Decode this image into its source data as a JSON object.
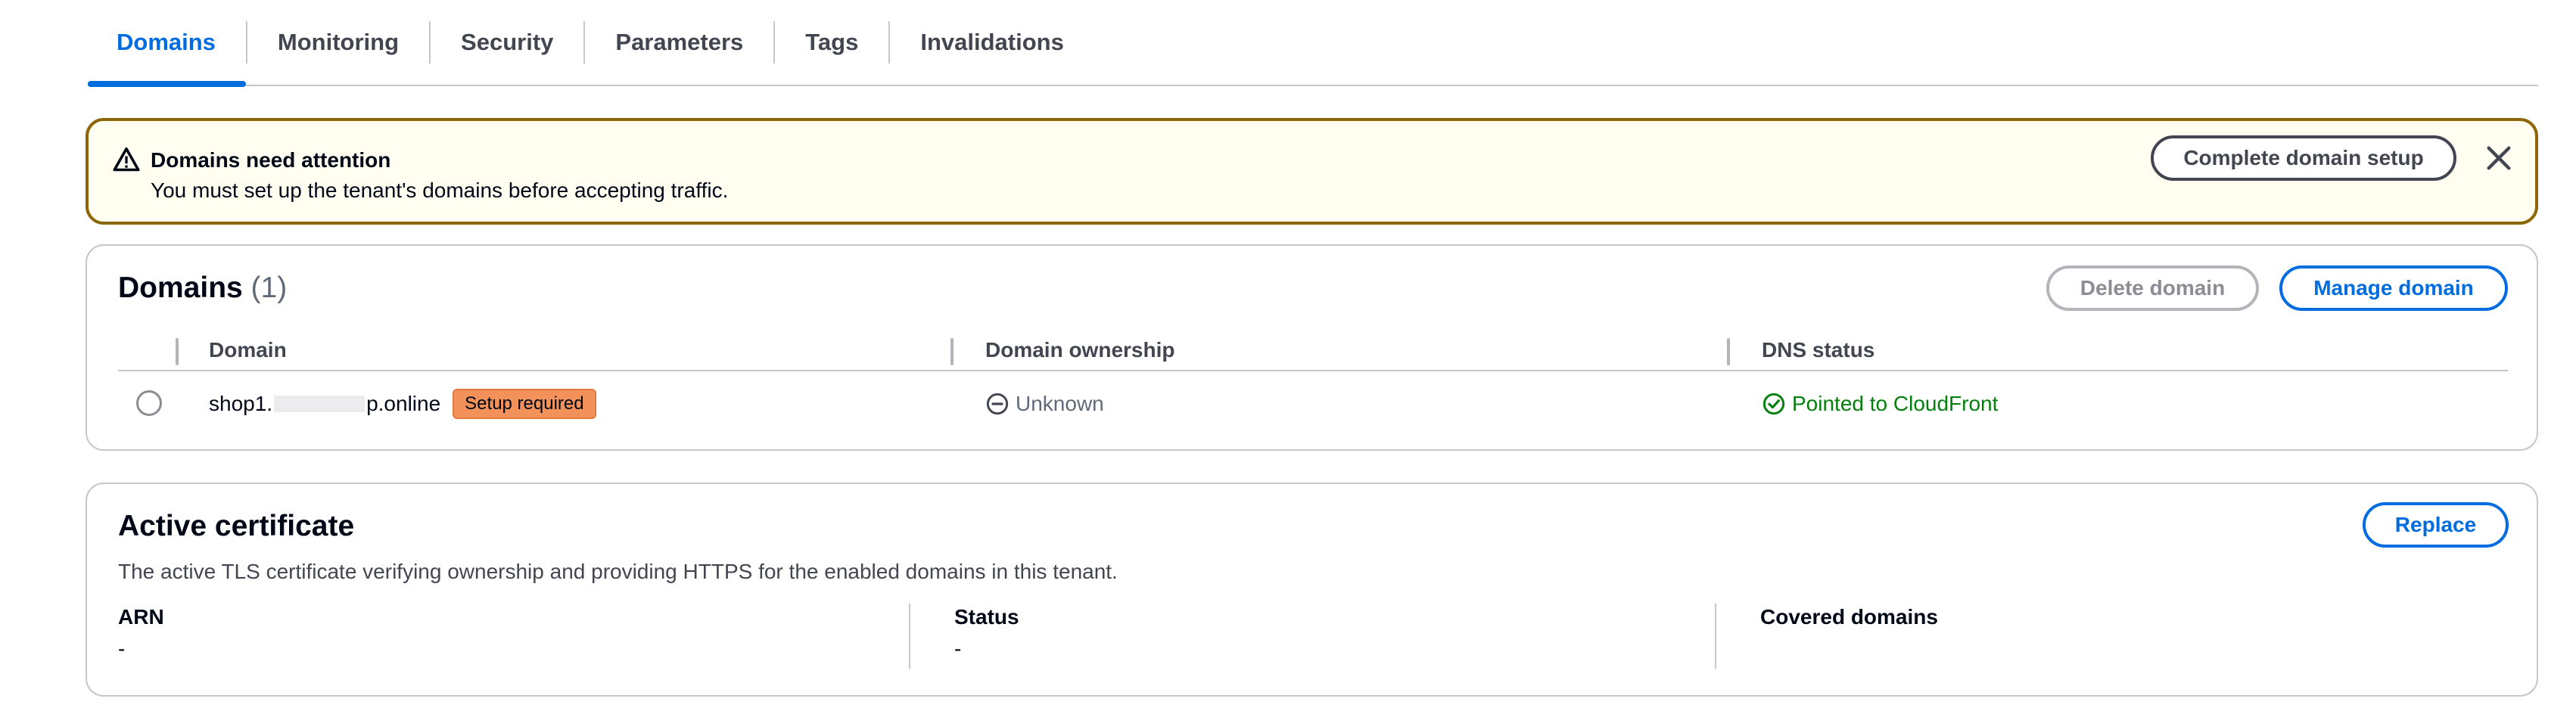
{
  "tabs": [
    {
      "label": "Domains",
      "active": true
    },
    {
      "label": "Monitoring"
    },
    {
      "label": "Security"
    },
    {
      "label": "Parameters"
    },
    {
      "label": "Tags"
    },
    {
      "label": "Invalidations"
    }
  ],
  "alert": {
    "icon": "warning-icon",
    "title": "Domains need attention",
    "message": "You must set up the tenant's domains before accepting traffic.",
    "action_label": "Complete domain setup",
    "close_icon": "close-icon",
    "border_color": "#8d6605",
    "background_color": "#fffef0"
  },
  "domains": {
    "title": "Domains",
    "count": "(1)",
    "delete_label": "Delete domain",
    "manage_label": "Manage domain",
    "columns": [
      "Domain",
      "Domain ownership",
      "DNS status"
    ],
    "rows": [
      {
        "domain_prefix": "shop1.",
        "domain_suffix": "p.online",
        "badge": "Setup required",
        "ownership": "Unknown",
        "ownership_icon": "minus-circle-icon",
        "dns_status": "Pointed to CloudFront",
        "dns_icon": "check-circle-icon"
      }
    ]
  },
  "certificate": {
    "title": "Active certificate",
    "description": "The active TLS certificate verifying ownership and providing HTTPS for the enabled domains in this tenant.",
    "replace_label": "Replace",
    "fields": [
      {
        "label": "ARN",
        "value": "-"
      },
      {
        "label": "Status",
        "value": "-"
      },
      {
        "label": "Covered domains",
        "value": ""
      }
    ]
  },
  "colors": {
    "accent": "#006ce0",
    "success": "#037f0c",
    "badge": "#f2915a"
  }
}
